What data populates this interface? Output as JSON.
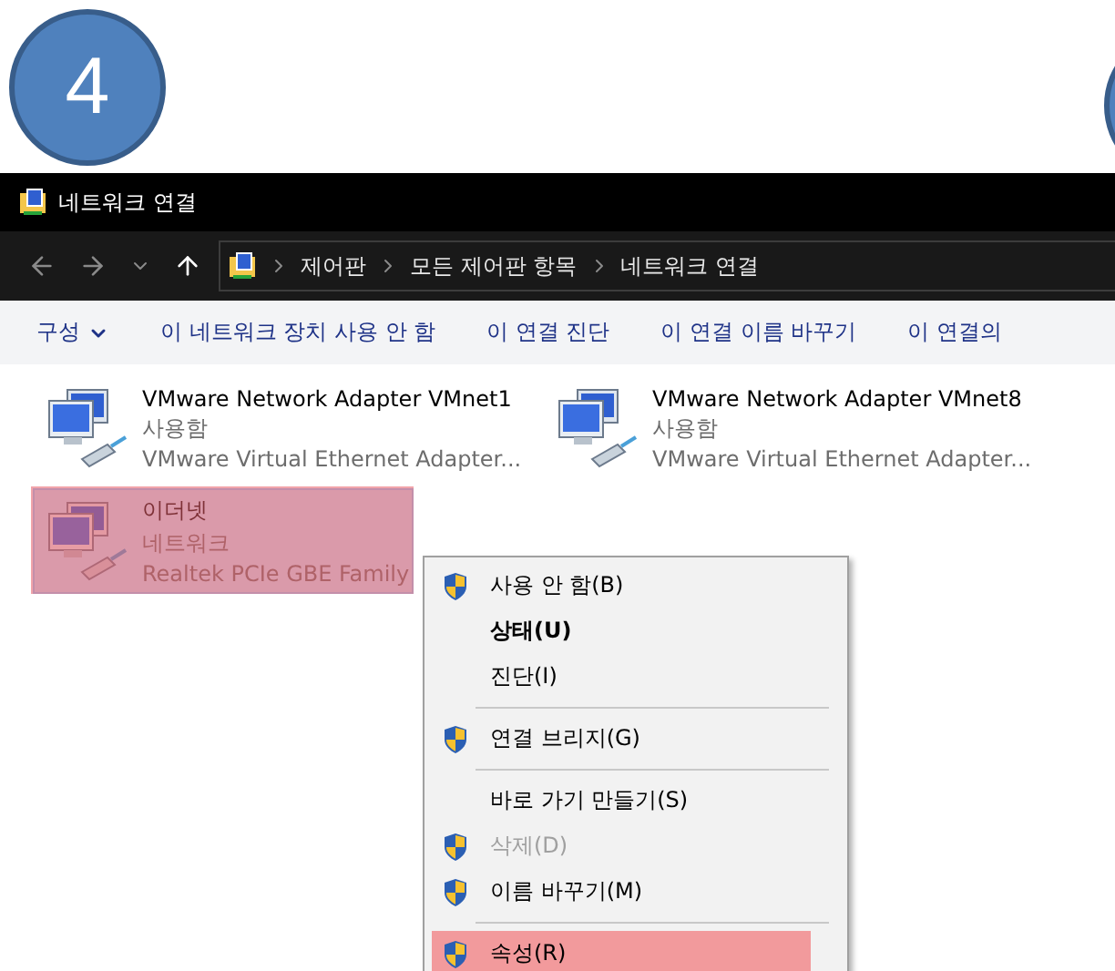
{
  "step_badge": {
    "label": "4"
  },
  "window": {
    "title": "네트워크 연결"
  },
  "address_bar": {
    "crumbs": [
      "제어판",
      "모든 제어판 항목",
      "네트워크 연결"
    ]
  },
  "command_bar": {
    "items": [
      {
        "label": "구성",
        "dropdown": true
      },
      {
        "label": "이 네트워크 장치 사용 안 함",
        "dropdown": false
      },
      {
        "label": "이 연결 진단",
        "dropdown": false
      },
      {
        "label": "이 연결 이름 바꾸기",
        "dropdown": false
      },
      {
        "label": "이 연결의",
        "dropdown": false
      }
    ]
  },
  "connections": [
    {
      "name": "VMware Network Adapter VMnet1",
      "status": "사용함",
      "device": "VMware Virtual Ethernet Adapter...",
      "selected": false,
      "highlighted": false
    },
    {
      "name": "VMware Network Adapter VMnet8",
      "status": "사용함",
      "device": "VMware Virtual Ethernet Adapter...",
      "selected": false,
      "highlighted": false
    },
    {
      "name": "이더넷",
      "status": "네트워크",
      "device": "Realtek PCIe GBE Family",
      "selected": true,
      "highlighted": true
    }
  ],
  "context_menu": {
    "items": [
      {
        "kind": "item",
        "label": "사용 안 함(B)",
        "shield": true,
        "bold": false,
        "disabled": false,
        "highlighted": false
      },
      {
        "kind": "item",
        "label": "상태(U)",
        "shield": false,
        "bold": true,
        "disabled": false,
        "highlighted": false
      },
      {
        "kind": "item",
        "label": "진단(I)",
        "shield": false,
        "bold": false,
        "disabled": false,
        "highlighted": false
      },
      {
        "kind": "separator"
      },
      {
        "kind": "item",
        "label": "연결 브리지(G)",
        "shield": true,
        "bold": false,
        "disabled": false,
        "highlighted": false
      },
      {
        "kind": "separator"
      },
      {
        "kind": "item",
        "label": "바로 가기 만들기(S)",
        "shield": false,
        "bold": false,
        "disabled": false,
        "highlighted": false
      },
      {
        "kind": "item",
        "label": "삭제(D)",
        "shield": true,
        "bold": false,
        "disabled": true,
        "highlighted": false
      },
      {
        "kind": "item",
        "label": "이름 바꾸기(M)",
        "shield": true,
        "bold": false,
        "disabled": false,
        "highlighted": false
      },
      {
        "kind": "separator"
      },
      {
        "kind": "item",
        "label": "속성(R)",
        "shield": true,
        "bold": false,
        "disabled": false,
        "highlighted": true
      }
    ]
  }
}
